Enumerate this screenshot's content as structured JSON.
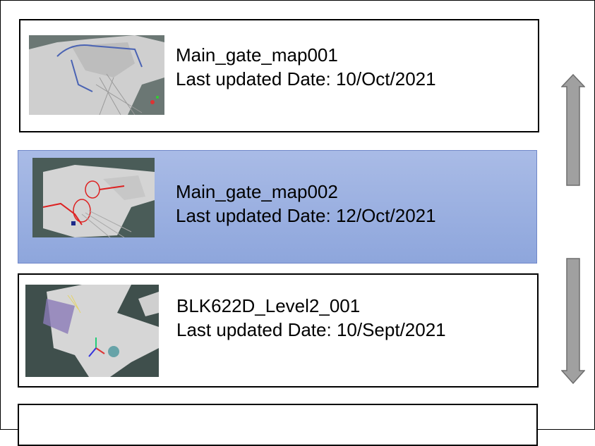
{
  "maps": [
    {
      "name": "Main_gate_map001",
      "updated": "Last updated Date: 10/Oct/2021",
      "selected": false
    },
    {
      "name": "Main_gate_map002",
      "updated": "Last updated Date: 12/Oct/2021",
      "selected": true
    },
    {
      "name": "BLK622D_Level2_001",
      "updated": "Last updated Date: 10/Sept/2021",
      "selected": false
    }
  ],
  "scroll": {
    "up_icon": "arrow-up-icon",
    "down_icon": "arrow-down-icon"
  },
  "colors": {
    "selected_bg": "#9db0e2",
    "border": "#000000",
    "arrow_fill": "#a0a0a0"
  }
}
